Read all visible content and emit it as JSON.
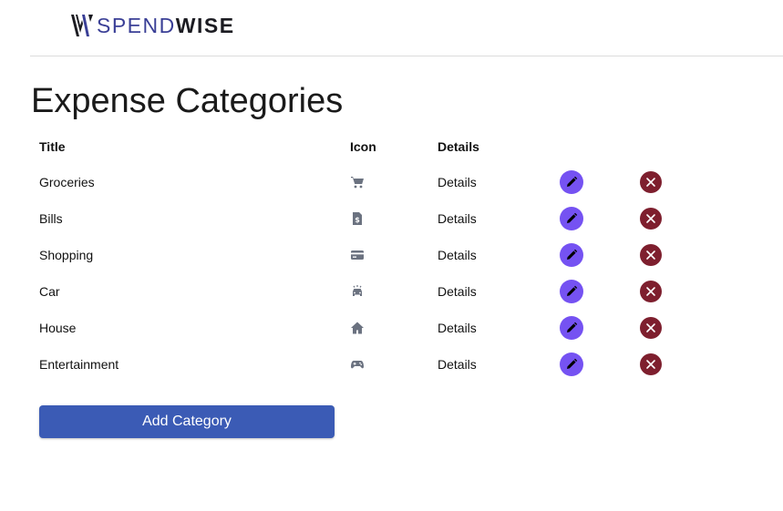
{
  "brand": {
    "name_part1": "SPEND",
    "name_part2": "WISE",
    "colors": {
      "part1": "#3a3f96",
      "part2": "#1c1c22"
    }
  },
  "page_title": "Expense Categories",
  "table": {
    "headers": {
      "title": "Title",
      "icon": "Icon",
      "details": "Details"
    },
    "rows": [
      {
        "title": "Groceries",
        "icon": "shopping-cart-icon",
        "details": "Details"
      },
      {
        "title": "Bills",
        "icon": "invoice-icon",
        "details": "Details"
      },
      {
        "title": "Shopping",
        "icon": "credit-card-icon",
        "details": "Details"
      },
      {
        "title": "Car",
        "icon": "car-icon",
        "details": "Details"
      },
      {
        "title": "House",
        "icon": "home-icon",
        "details": "Details"
      },
      {
        "title": "Entertainment",
        "icon": "gamepad-icon",
        "details": "Details"
      }
    ]
  },
  "actions": {
    "edit_color": "#7552f2",
    "delete_color": "#7e1f2e"
  },
  "add_button_label": "Add Category",
  "colors": {
    "primary_button": "#3b5bb5",
    "icon_gray": "#6b7280"
  }
}
